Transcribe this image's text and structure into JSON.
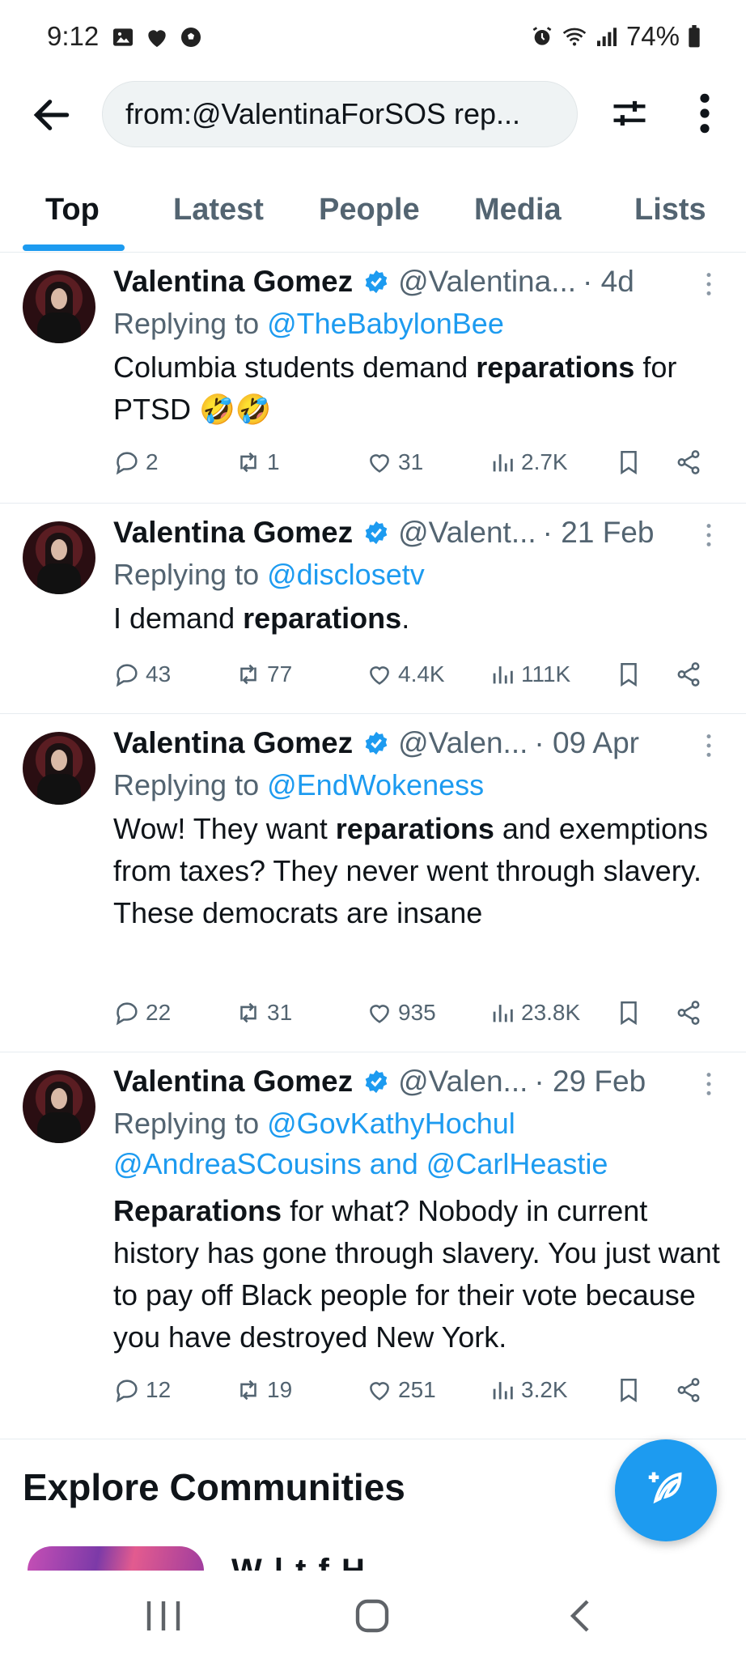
{
  "status_bar": {
    "time": "9:12",
    "battery": "74%",
    "left_icons": [
      "image-icon",
      "heart-icon",
      "soccer-ball-icon"
    ],
    "right_icons": [
      "alarm-icon",
      "wifi-icon",
      "signal-icon",
      "battery-icon"
    ]
  },
  "search": {
    "query": "from:@ValentinaForSOS rep..."
  },
  "tabs": [
    {
      "label": "Top",
      "active": true
    },
    {
      "label": "Latest",
      "active": false
    },
    {
      "label": "People",
      "active": false
    },
    {
      "label": "Media",
      "active": false
    },
    {
      "label": "Lists",
      "active": false
    }
  ],
  "tweets": [
    {
      "name": "Valentina Gomez",
      "handle": "@Valentina...",
      "time": "· 4d",
      "replying_prefix": "Replying to ",
      "mentions_line1": "@TheBabylonBee",
      "mentions_line2": "",
      "text_before": "Columbia students demand ",
      "text_bold": "reparations",
      "text_after": " for PTSD 🤣🤣",
      "text_lead_bold": "",
      "replies": "2",
      "retweets": "1",
      "likes": "31",
      "views": "2.7K"
    },
    {
      "name": "Valentina Gomez",
      "handle": "@Valent...",
      "time": "· 21 Feb",
      "replying_prefix": "Replying to ",
      "mentions_line1": "@disclosetv",
      "mentions_line2": "",
      "text_before": "I demand ",
      "text_bold": "reparations",
      "text_after": ".",
      "text_lead_bold": "",
      "replies": "43",
      "retweets": "77",
      "likes": "4.4K",
      "views": "111K"
    },
    {
      "name": "Valentina Gomez",
      "handle": "@Valen...",
      "time": "· 09 Apr",
      "replying_prefix": "Replying to ",
      "mentions_line1": "@EndWokeness",
      "mentions_line2": "",
      "text_before": "Wow! They want ",
      "text_bold": "reparations",
      "text_after": " and exemptions from taxes? They never went through slavery. These democrats are insane",
      "text_lead_bold": "",
      "replies": "22",
      "retweets": "31",
      "likes": "935",
      "views": "23.8K"
    },
    {
      "name": "Valentina Gomez",
      "handle": "@Valen...",
      "time": "· 29 Feb",
      "replying_prefix": "Replying to ",
      "mentions_line1": "@GovKathyHochul",
      "mentions_line2": "@AndreaSCousins and @CarlHeastie",
      "text_before": "",
      "text_bold": "Reparations",
      "text_after": " for what? Nobody in current history has gone through slavery. You just want to pay off Black people for their vote because you have destroyed New York.",
      "text_lead_bold": "",
      "replies": "12",
      "retweets": "19",
      "likes": "251",
      "views": "3.2K"
    }
  ],
  "explore": {
    "title": "Explore Communities",
    "peek_text": "W l t f H"
  },
  "colors": {
    "accent": "#1d9bf0",
    "text_primary": "#0f1419",
    "text_secondary": "#536471",
    "divider": "#e6ecf0"
  }
}
